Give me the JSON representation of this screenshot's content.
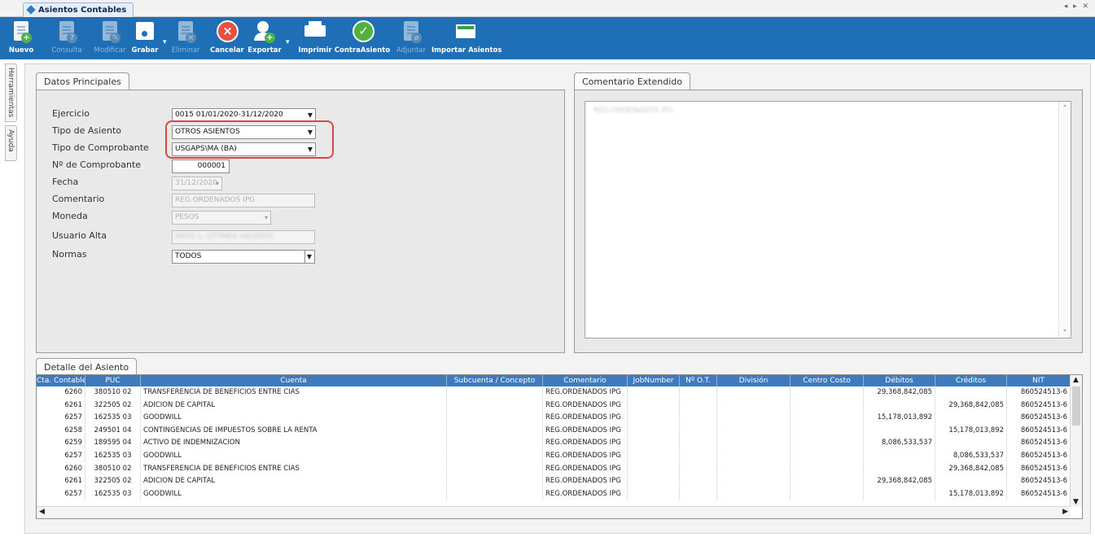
{
  "window": {
    "tab_title": "Asientos Contables",
    "controls": "◂ ▸ ✕"
  },
  "toolbar": [
    {
      "id": "nuevo",
      "label": "Nuevo",
      "enabled": true,
      "icon": "new-document-icon"
    },
    {
      "id": "consulta",
      "label": "Consulta",
      "enabled": false,
      "icon": "query-document-icon"
    },
    {
      "id": "modificar",
      "label": "Modificar",
      "enabled": false,
      "icon": "edit-document-icon"
    },
    {
      "id": "grabar",
      "label": "Grabar",
      "enabled": true,
      "icon": "save-floppy-icon"
    },
    {
      "id": "eliminar",
      "label": "Eliminar",
      "enabled": false,
      "icon": "delete-document-icon"
    },
    {
      "id": "cancelar",
      "label": "Cancelar",
      "enabled": true,
      "icon": "cancel-circle-icon"
    },
    {
      "id": "exportar",
      "label": "Exportar",
      "enabled": true,
      "icon": "export-user-icon"
    },
    {
      "id": "imprimir",
      "label": "Imprimir",
      "enabled": true,
      "icon": "printer-icon"
    },
    {
      "id": "contraasiento",
      "label": "ContraAsiento",
      "enabled": true,
      "icon": "check-circle-icon"
    },
    {
      "id": "adjuntar",
      "label": "Adjuntar",
      "enabled": false,
      "icon": "attach-document-icon"
    },
    {
      "id": "importar",
      "label": "Importar Asientos",
      "enabled": true,
      "icon": "import-sheet-icon"
    }
  ],
  "side_tabs": {
    "herramientas": "Herramientas",
    "ayuda": "Ayuda"
  },
  "datos": {
    "tab": "Datos Principales",
    "ejercicio_label": "Ejercicio",
    "ejercicio_value": "0015 01/01/2020-31/12/2020",
    "tipo_asiento_label": "Tipo de Asiento",
    "tipo_asiento_value": "OTROS ASIENTOS",
    "tipo_comprobante_label": "Tipo de Comprobante",
    "tipo_comprobante_value": "USGAPS\\MA (BA)",
    "numero_label": "Nº de Comprobante",
    "numero_value": "000001",
    "fecha_label": "Fecha",
    "fecha_value": "31/12/2020",
    "comentario_label": "Comentario",
    "comentario_value": "REG.ORDENADOS IPG",
    "moneda_label": "Moneda",
    "moneda_value": "PESOS",
    "usuario_label": "Usuario Alta",
    "usuario_value": "AROS L. OTYMEA VALEROS",
    "normas_label": "Normas",
    "normas_value": "TODOS"
  },
  "comentario_ext": {
    "tab": "Comentario Extendido",
    "text": "REG.ORDENADOS IPG"
  },
  "detalle": {
    "tab": "Detalle del Asiento",
    "columns": [
      "Cta. Contable",
      "PUC",
      "Cuenta",
      "Subcuenta / Concepto",
      "Comentario",
      "JobNumber",
      "Nº O.T.",
      "División",
      "Centro Costo",
      "Débitos",
      "Créditos",
      "NIT"
    ],
    "rows": [
      [
        "6260",
        "380510 02",
        "TRANSFERENCIA DE BENEFICIOS ENTRE CIAS",
        "",
        "REG.ORDENADOS IPG",
        "",
        "",
        "",
        "",
        "29,368,842,085",
        "",
        "860524513-6"
      ],
      [
        "6261",
        "322505 02",
        "ADICION DE CAPITAL",
        "",
        "REG.ORDENADOS IPG",
        "",
        "",
        "",
        "",
        "",
        "29,368,842,085",
        "860524513-6"
      ],
      [
        "6257",
        "162535 03",
        "GOODWILL",
        "",
        "REG.ORDENADOS IPG",
        "",
        "",
        "",
        "",
        "15,178,013,892",
        "",
        "860524513-6"
      ],
      [
        "6258",
        "249501 04",
        "CONTINGENCIAS DE IMPUESTOS SOBRE LA RENTA",
        "",
        "REG.ORDENADOS IPG",
        "",
        "",
        "",
        "",
        "",
        "15,178,013,892",
        "860524513-6"
      ],
      [
        "6259",
        "189595 04",
        "ACTIVO DE INDEMNIZACION",
        "",
        "REG.ORDENADOS IPG",
        "",
        "",
        "",
        "",
        "8,086,533,537",
        "",
        "860524513-6"
      ],
      [
        "6257",
        "162535 03",
        "GOODWILL",
        "",
        "REG.ORDENADOS IPG",
        "",
        "",
        "",
        "",
        "",
        "8,086,533,537",
        "860524513-6"
      ],
      [
        "6260",
        "380510 02",
        "TRANSFERENCIA DE BENEFICIOS ENTRE CIAS",
        "",
        "REG.ORDENADOS IPG",
        "",
        "",
        "",
        "",
        "",
        "29,368,842,085",
        "860524513-6"
      ],
      [
        "6261",
        "322505 02",
        "ADICION DE CAPITAL",
        "",
        "REG.ORDENADOS IPG",
        "",
        "",
        "",
        "",
        "29,368,842,085",
        "",
        "860524513-6"
      ],
      [
        "6257",
        "162535 03",
        "GOODWILL",
        "",
        "REG.ORDENADOS IPG",
        "",
        "",
        "",
        "",
        "",
        "15,178,013,892",
        "860524513-6"
      ]
    ]
  }
}
